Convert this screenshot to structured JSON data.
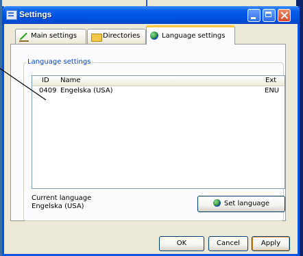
{
  "window": {
    "title": "Settings"
  },
  "tabs": [
    {
      "label": "Main settings",
      "icon": "checkmark-pencil-icon"
    },
    {
      "label": "Directories",
      "icon": "folder-icon"
    },
    {
      "label": "Language settings",
      "icon": "globe-icon",
      "active": true
    }
  ],
  "language_group": {
    "label": "Language settings",
    "columns": [
      "ID",
      "Name",
      "Ext"
    ],
    "rows": [
      {
        "id": "0409",
        "name": "Engelska (USA)",
        "ext": "ENU"
      }
    ],
    "current_label": "Current language",
    "current_value": "Engelska (USA)",
    "set_button": "Set language"
  },
  "footer": {
    "ok": "OK",
    "cancel": "Cancel",
    "apply": "Apply"
  },
  "colors": {
    "titlebar": "#0054e3",
    "face": "#ece9d8",
    "group_label": "#0046d5"
  }
}
